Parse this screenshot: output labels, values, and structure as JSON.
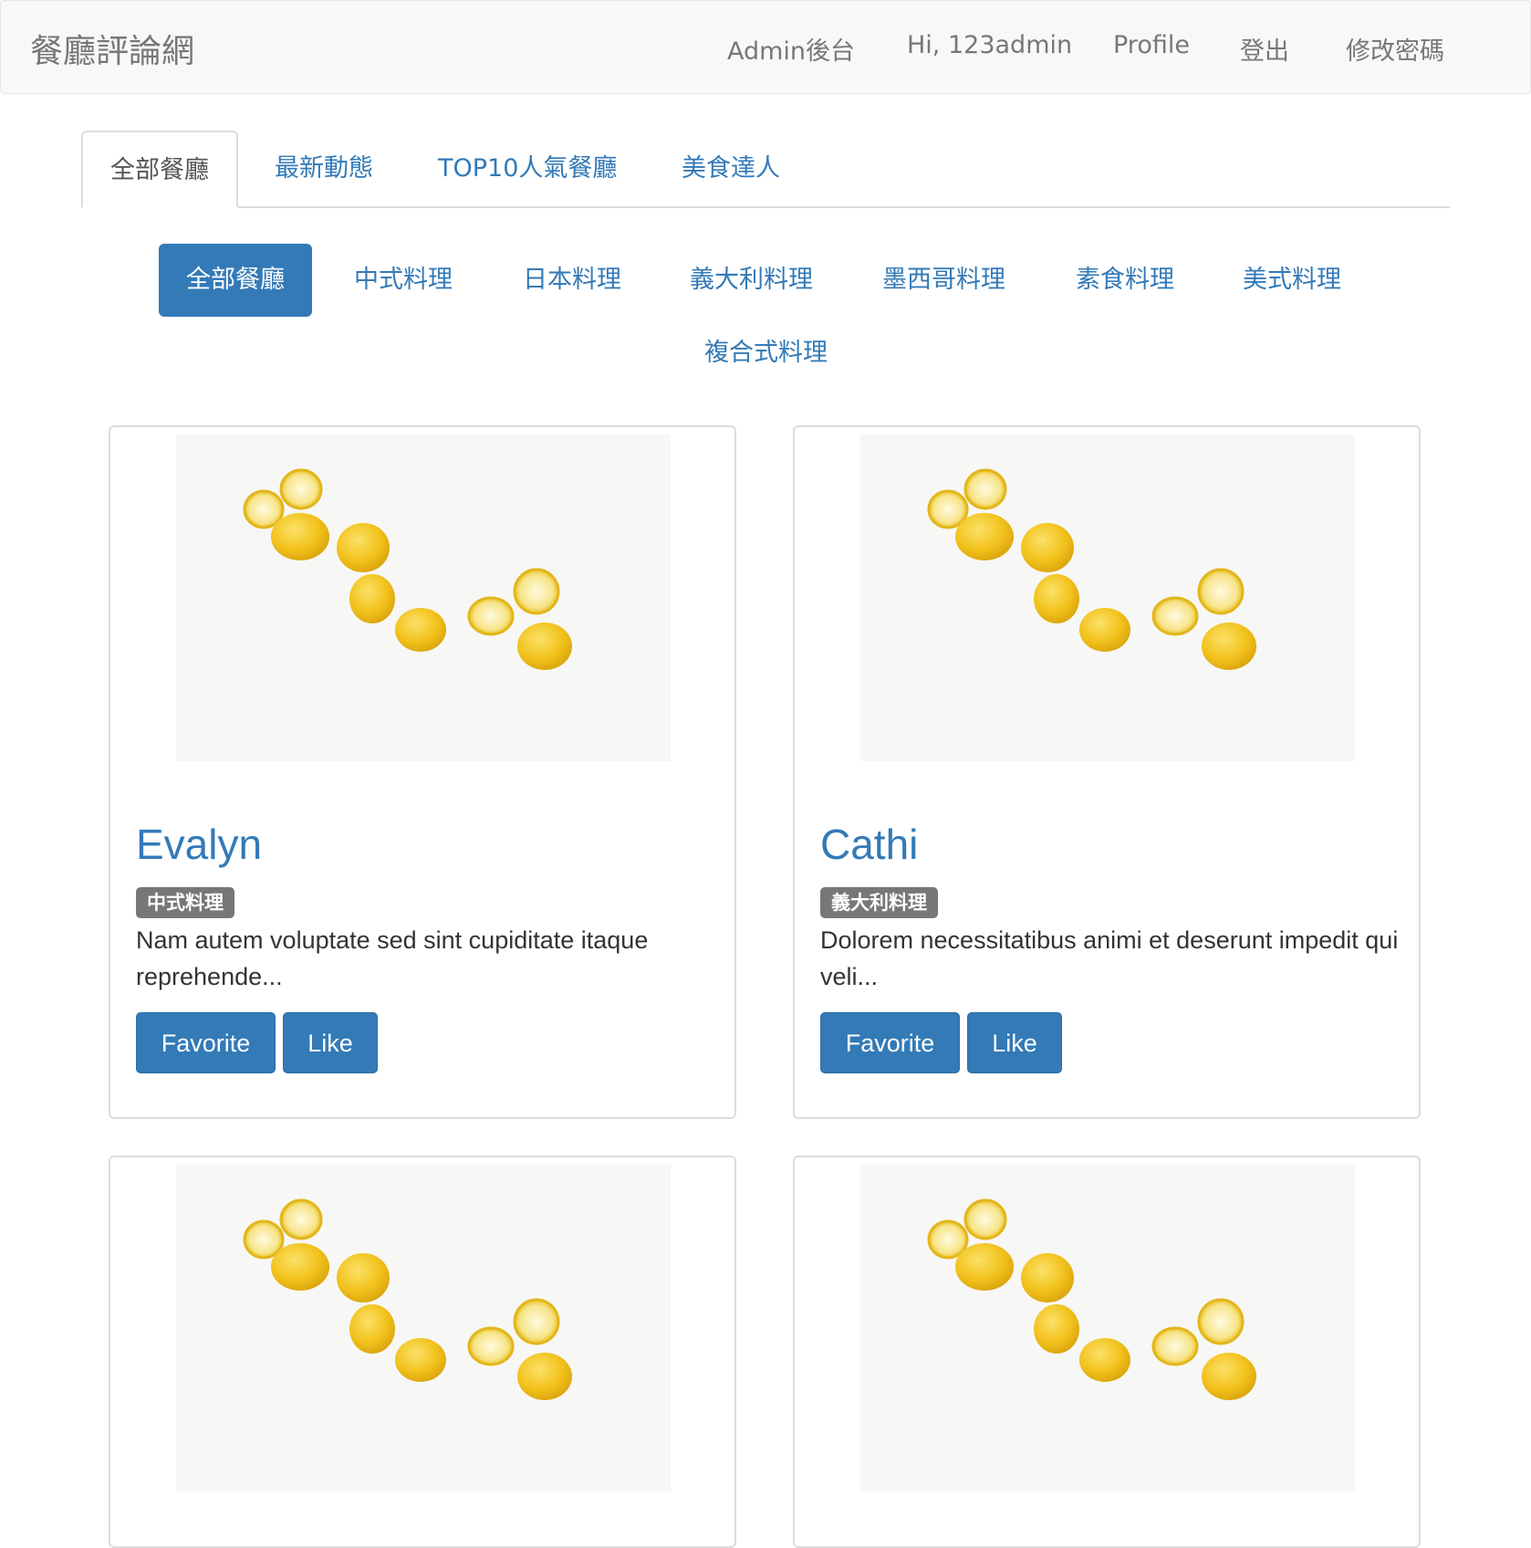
{
  "navbar": {
    "brand": "餐廳評論網",
    "links": [
      "Admin後台",
      "Hi, 123admin",
      "Profile",
      "登出",
      "修改密碼"
    ]
  },
  "tabs": [
    "全部餐廳",
    "最新動態",
    "TOP10人氣餐廳",
    "美食達人"
  ],
  "categories": [
    "全部餐廳",
    "中式料理",
    "日本料理",
    "義大利料理",
    "墨西哥料理",
    "素食料理",
    "美式料理",
    "複合式料理"
  ],
  "restaurants": [
    {
      "name": "Evalyn",
      "category": "中式料理",
      "description": "Nam autem voluptate sed sint cupiditate itaque reprehende...",
      "favorite_label": "Favorite",
      "like_label": "Like"
    },
    {
      "name": "Cathi",
      "category": "義大利料理",
      "description": "Dolorem necessitatibus animi et deserunt impedit qui veli...",
      "favorite_label": "Favorite",
      "like_label": "Like"
    }
  ],
  "colors": {
    "primary": "#337ab7",
    "navbar_bg": "#f8f8f8",
    "badge": "#777777",
    "lemon": "#f2c21c"
  }
}
